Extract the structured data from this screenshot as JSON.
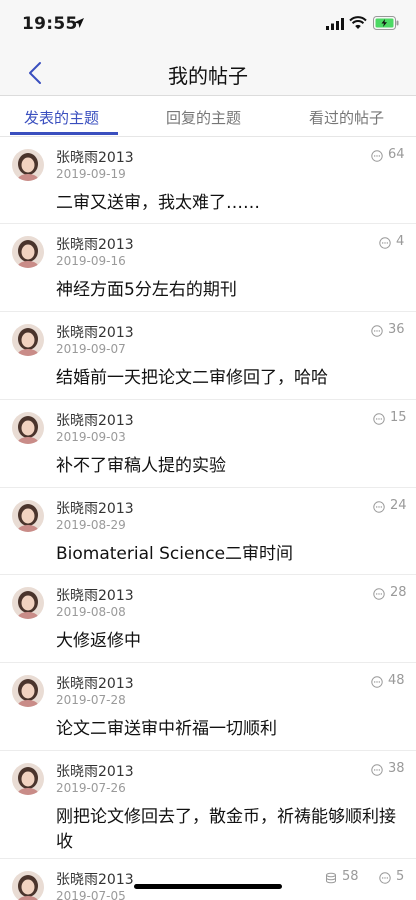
{
  "status_bar": {
    "time": "19:55"
  },
  "nav": {
    "title": "我的帖子"
  },
  "tabs": [
    {
      "label": "发表的主题",
      "active": true
    },
    {
      "label": "回复的主题",
      "active": false
    },
    {
      "label": "看过的帖子",
      "active": false
    }
  ],
  "posts": [
    {
      "user": "张晓雨2013",
      "date": "2019-09-19",
      "reply_count": "64",
      "title": "二审又送审，我太难了……"
    },
    {
      "user": "张晓雨2013",
      "date": "2019-09-16",
      "reply_count": "4",
      "title": "神经方面5分左右的期刊"
    },
    {
      "user": "张晓雨2013",
      "date": "2019-09-07",
      "reply_count": "36",
      "title": "结婚前一天把论文二审修回了，哈哈"
    },
    {
      "user": "张晓雨2013",
      "date": "2019-09-03",
      "reply_count": "15",
      "title": "补不了审稿人提的实验"
    },
    {
      "user": "张晓雨2013",
      "date": "2019-08-29",
      "reply_count": "24",
      "title": "Biomaterial Science二审时间"
    },
    {
      "user": "张晓雨2013",
      "date": "2019-08-08",
      "reply_count": "28",
      "title": "大修返修中"
    },
    {
      "user": "张晓雨2013",
      "date": "2019-07-28",
      "reply_count": "48",
      "title": "论文二审送审中祈福一切顺利"
    },
    {
      "user": "张晓雨2013",
      "date": "2019-07-26",
      "reply_count": "38",
      "title": "刚把论文修回去了，散金币，祈祷能够顺利接收"
    },
    {
      "user": "张晓雨2013",
      "date": "2019-07-05",
      "coin_count": "58",
      "reply_count": "5"
    }
  ],
  "colors": {
    "accent": "#3a4fbf",
    "muted": "#9a9a9a"
  }
}
